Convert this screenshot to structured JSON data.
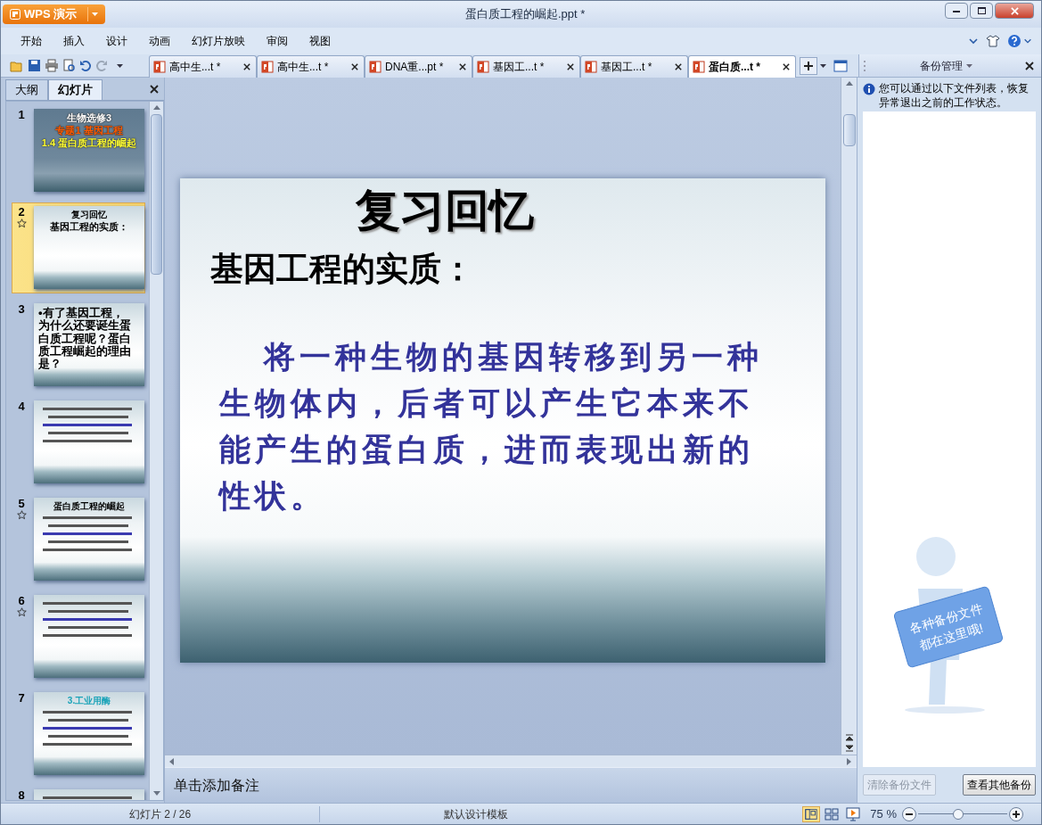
{
  "app": {
    "name": "WPS 演示"
  },
  "window": {
    "title": "蛋白质工程的崛起.ppt *"
  },
  "menu": [
    {
      "label": "开始"
    },
    {
      "label": "插入"
    },
    {
      "label": "设计"
    },
    {
      "label": "动画"
    },
    {
      "label": "幻灯片放映"
    },
    {
      "label": "审阅"
    },
    {
      "label": "视图"
    }
  ],
  "doc_tabs": [
    {
      "label": "高中生...t *",
      "selected": false
    },
    {
      "label": "高中生...t *",
      "selected": false
    },
    {
      "label": "DNA重...pt *",
      "selected": false
    },
    {
      "label": "基因工...t *",
      "selected": false
    },
    {
      "label": "基因工...t *",
      "selected": false
    },
    {
      "label": "蛋白质...t *",
      "selected": true
    }
  ],
  "panel_tabs": [
    {
      "label": "大纲",
      "selected": false
    },
    {
      "label": "幻灯片",
      "selected": true
    }
  ],
  "slides": [
    {
      "number": "1",
      "selected": false,
      "animated": false,
      "lines": [
        {
          "text": "生物选修3",
          "color": "#ffffff"
        },
        {
          "text": "专题1  基因工程",
          "color": "#ff5a00"
        },
        {
          "text": "1.4  蛋白质工程的崛起",
          "color": "#ffff33"
        }
      ]
    },
    {
      "number": "2",
      "selected": true,
      "animated": true,
      "lines": [
        {
          "text": "复习回忆",
          "color": "#000000"
        },
        {
          "text": "基因工程的实质：",
          "color": "#000000"
        }
      ]
    },
    {
      "number": "3",
      "selected": false,
      "animated": false,
      "lines": [
        {
          "text": "•有了基因工程，为什么还要诞生蛋白质工程呢？蛋白质工程崛起的理由是？",
          "color": "#000000"
        }
      ]
    },
    {
      "number": "4",
      "selected": false,
      "animated": false
    },
    {
      "number": "5",
      "selected": false,
      "animated": true,
      "lines": [
        {
          "text": "蛋白质工程的崛起",
          "color": "#000000"
        }
      ]
    },
    {
      "number": "6",
      "selected": false,
      "animated": true
    },
    {
      "number": "7",
      "selected": false,
      "animated": false,
      "lines": [
        {
          "text": "3.工业用酶",
          "color": "#1aa3b8"
        }
      ]
    },
    {
      "number": "8",
      "selected": false,
      "animated": false
    }
  ],
  "current_slide": {
    "title": "复习回忆",
    "heading": "基因工程的实质：",
    "body": "将一种生物的基因转移到另一种生物体内，后者可以产生它本来不能产生的蛋白质，进而表现出新的性状。"
  },
  "notes": {
    "placeholder": "单击添加备注"
  },
  "backup_panel": {
    "title": "备份管理",
    "info": "您可以通过以下文件列表，恢复异常退出之前的工作状态。",
    "sign_lines": [
      "各种备份文件",
      "都在这里哦!"
    ],
    "buttons": [
      {
        "label": "清除备份文件",
        "disabled": true
      },
      {
        "label": "查看其他备份",
        "disabled": false
      }
    ]
  },
  "status_bar": {
    "slide_count": "幻灯片 2 / 26",
    "template": "默认设计模板",
    "zoom": "75 %",
    "zoom_slider": {
      "level": 0.45
    }
  }
}
